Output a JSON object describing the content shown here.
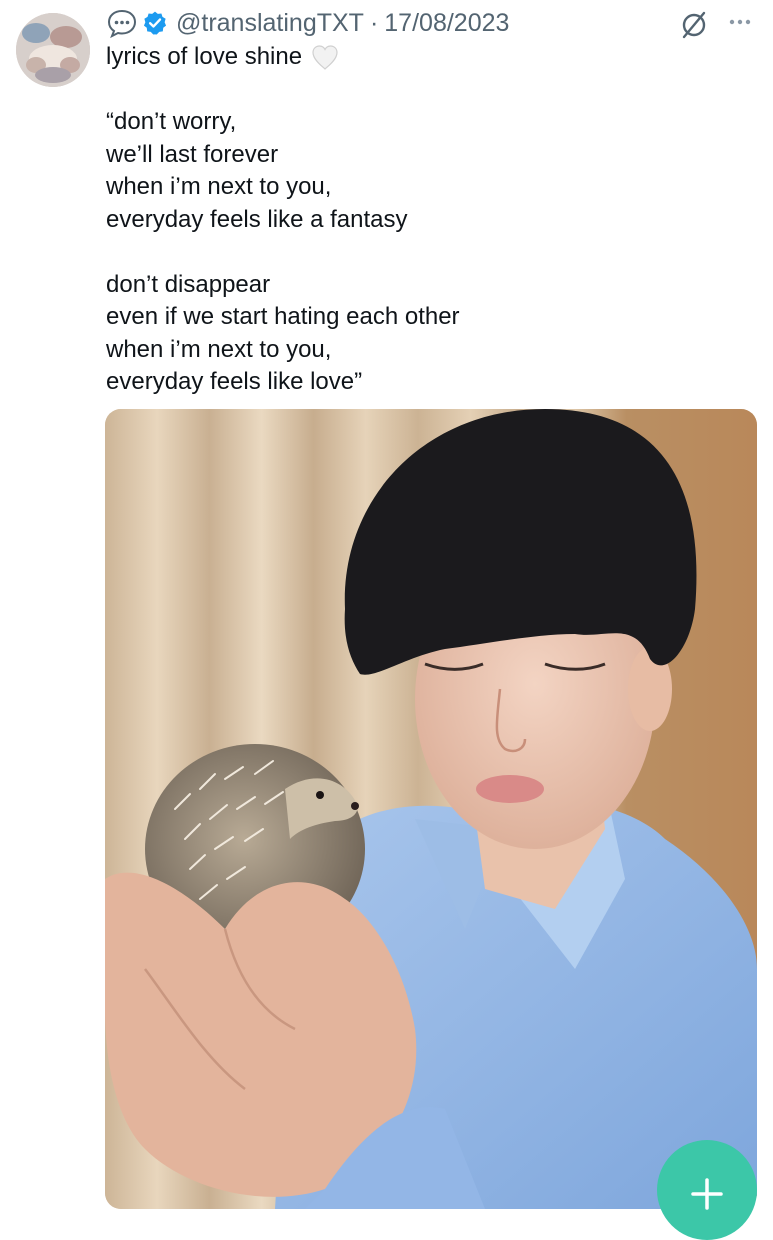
{
  "tweet": {
    "handle": "@translatingTXT",
    "separator": "·",
    "date": "17/08/2023",
    "title": "lyrics of love shine",
    "lyrics": [
      "“don’t worry,",
      "we’ll last forever",
      "when i’m next to you,",
      "everyday feels like a fantasy",
      "",
      "don’t disappear",
      "even if we start hating each other",
      "when i’m next to you,",
      "everyday feels like love”"
    ]
  },
  "icons": {
    "reply_bubble": "speech-bubble-ellipsis-icon",
    "verified": "verified-badge-icon",
    "slash": "slashed-circle-icon",
    "more": "more-horizontal-icon",
    "heart": "white-heart-icon",
    "fab": "plus-icon"
  },
  "colors": {
    "verified_blue": "#1d9bf0",
    "secondary_text": "#536471",
    "fab": "#3cc7a8"
  }
}
